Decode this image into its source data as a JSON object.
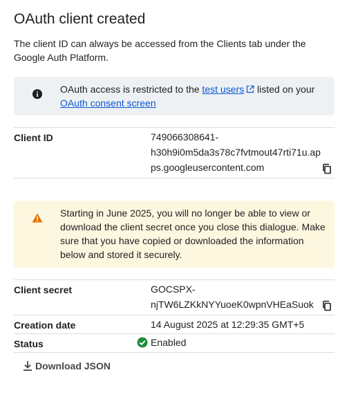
{
  "dialog": {
    "title": "OAuth client created",
    "intro": "The client ID can always be accessed from the Clients tab under the Google Auth Platform."
  },
  "info_banner": {
    "text_before": "OAuth access is restricted to the ",
    "link_test_users": "test users",
    "text_middle": " listed on your ",
    "link_consent": "OAuth consent screen"
  },
  "client_id": {
    "label": "Client ID",
    "value_line1": "749066308641-",
    "value_line2": "h30h9i0m5da3s78c7fvtmout47rti71u.ap",
    "value_line3": "ps.googleusercontent.com"
  },
  "warning_banner": {
    "text": "Starting in June 2025, you will no longer be able to view or download the client secret once you close this dialogue. Make sure that you have copied or downloaded the information below and stored it securely."
  },
  "client_secret": {
    "label": "Client secret",
    "value_line1": "GOCSPX-",
    "value_line2": "njTW6LZKkNYYuoeK0wpnVHEaSuok"
  },
  "creation_date": {
    "label": "Creation date",
    "value": "14 August 2025 at 12:29:35 GMT+5"
  },
  "status": {
    "label": "Status",
    "value": "Enabled"
  },
  "actions": {
    "download_label": "Download JSON"
  },
  "colors": {
    "link": "#0b57d0",
    "info_bg": "#eef1f4",
    "warning_bg": "#fef7e0",
    "warning_icon": "#e37400",
    "enabled_green": "#1e8e3e"
  },
  "icons": {
    "info": "info-icon",
    "external_link": "external-link-icon",
    "warning": "warning-icon",
    "copy": "copy-icon",
    "check_circle": "check-circle-icon",
    "download": "download-icon"
  }
}
